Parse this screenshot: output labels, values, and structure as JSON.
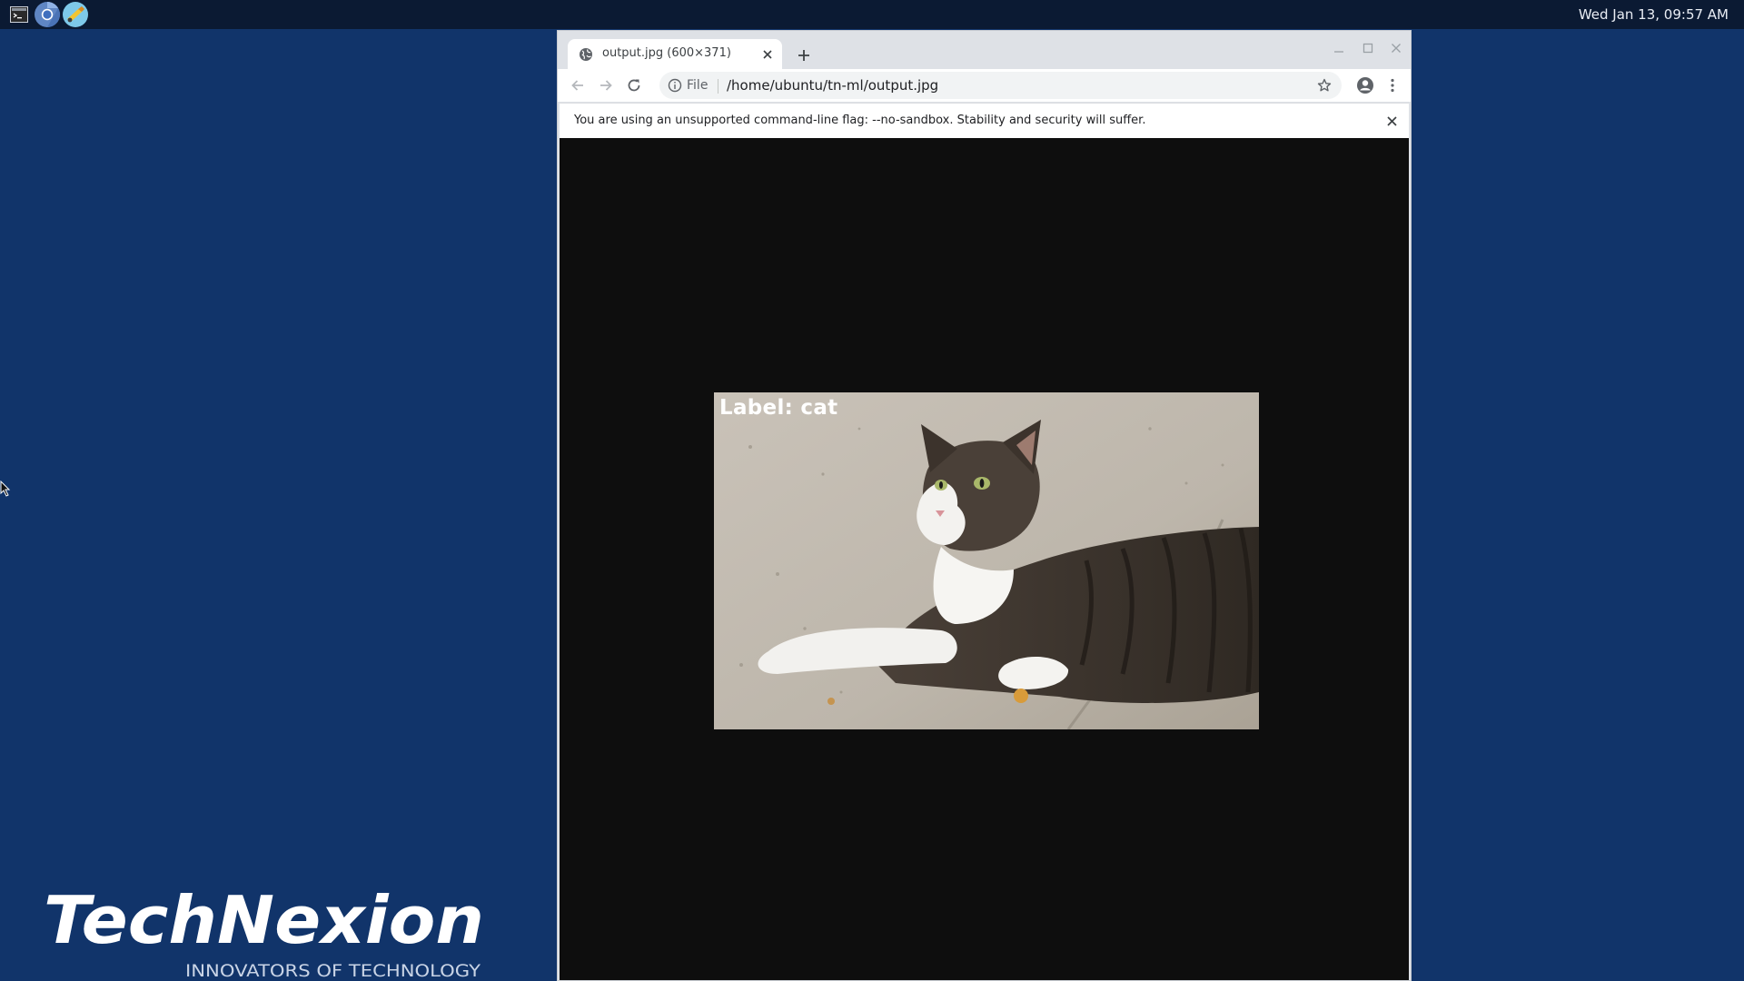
{
  "taskbar": {
    "launchers": [
      {
        "icon": "terminal-icon"
      },
      {
        "icon": "chromium-icon"
      },
      {
        "icon": "file-manager-icon"
      }
    ],
    "clock": "Wed Jan 13, 09:57 AM"
  },
  "desktop": {
    "logo": {
      "brand": "TechNexion",
      "tagline": "INNOVATORS OF TECHNOLOGY"
    },
    "background_color": "#11346a"
  },
  "browser": {
    "tab": {
      "title": "output.jpg (600×371)",
      "icon": "globe-icon"
    },
    "omnibox": {
      "scheme_label": "File",
      "url": "/home/ubuntu/tn-ml/output.jpg"
    },
    "infobar": {
      "message": "You are using an unsupported command-line flag: --no-sandbox. Stability and security will suffer."
    },
    "image": {
      "overlay_label": "Label: cat",
      "subject": "tabby-and-white cat lying on concrete"
    }
  }
}
